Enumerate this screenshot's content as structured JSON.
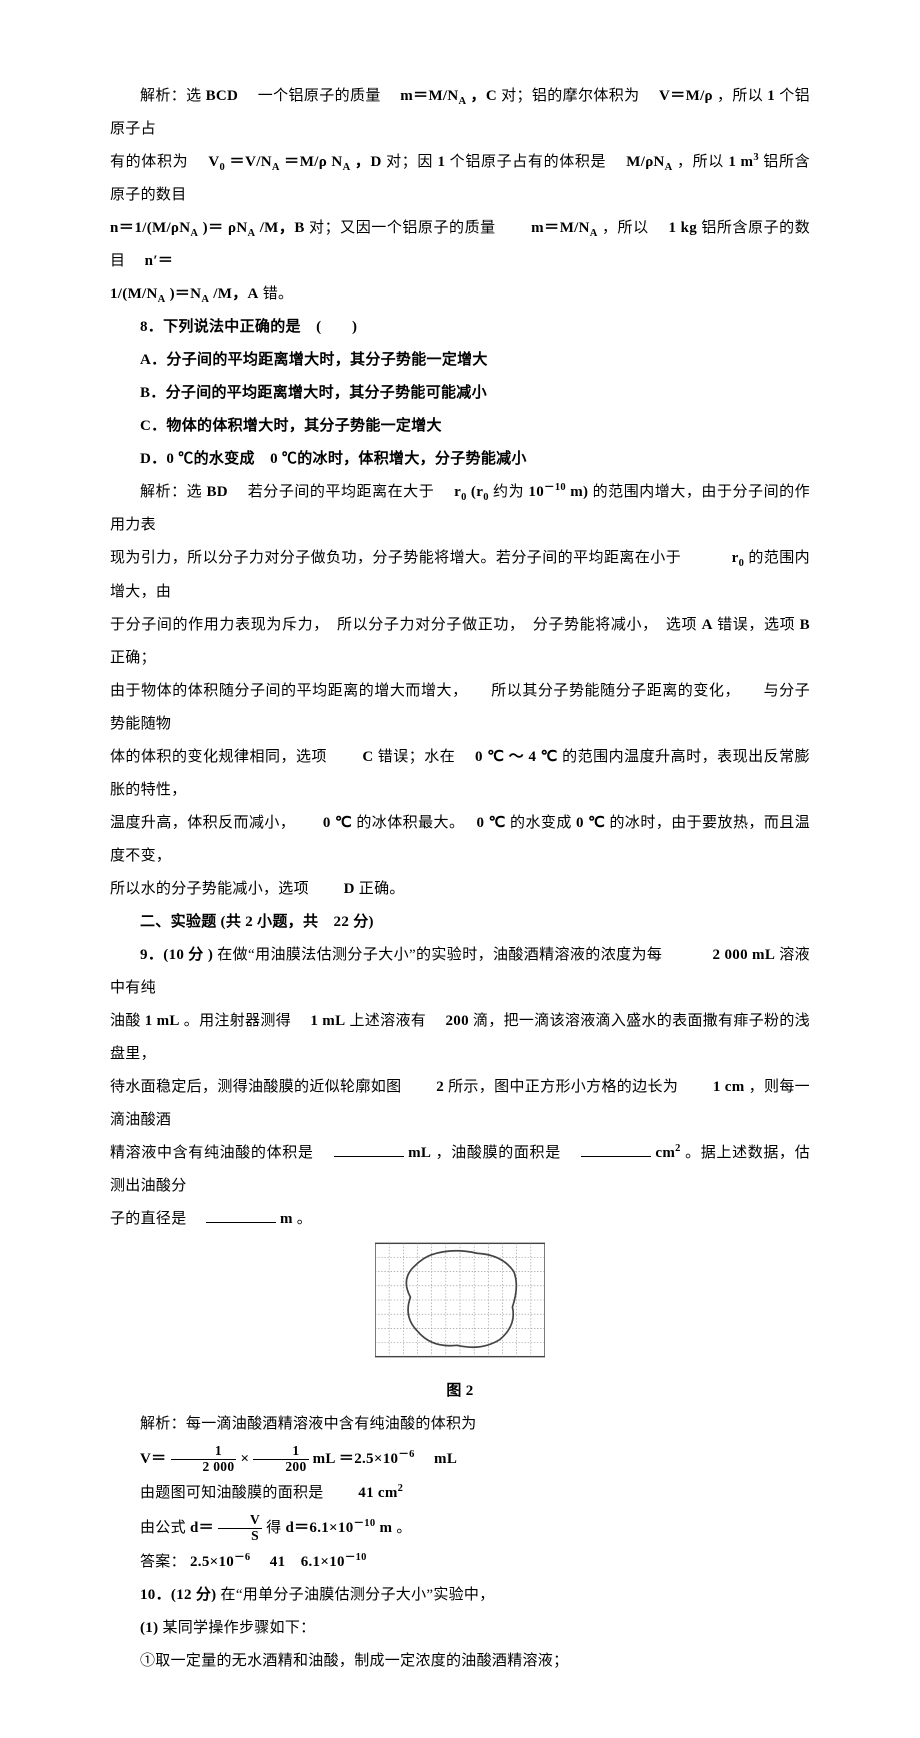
{
  "p7_analysis": {
    "t1": "解析：选 ",
    "t2": "BCD",
    "t3": "　一个铝原子的质量　",
    "t4": "m＝M/N",
    "t5": "A",
    "t6": "，C",
    "t7": " 对；铝的摩尔体积为　",
    "t8": "V＝M/ρ",
    "t9": "，所以 ",
    "t10": "1",
    "t11": " 个铝原子占",
    "t12": "有的体积为　",
    "t13": "V",
    "t14": "0",
    "t15": "＝V/N",
    "t16": "A",
    "t17": "＝M/ρ N",
    "t18": "A",
    "t19": "，D",
    "t20": " 对；因 ",
    "t21": "1",
    "t22": " 个铝原子占有的体积是　",
    "t23": "M/ρN",
    "t24": "A",
    "t25": "，所以 ",
    "t26": "1 m",
    "t27": "3",
    "t28": " 铝所含原子的数目",
    "t29": "n＝1/(M/ρN",
    "t30": "A",
    "t31": ")＝ ρN",
    "t32": "A",
    "t33": "/M，B",
    "t34": " 对；又因一个铝原子的质量　　",
    "t35": "m＝M/N",
    "t36": "A",
    "t37": "，所以　",
    "t38": "1 kg",
    "t39": " 铝所含原子的数目　",
    "t40": "n′＝",
    "t41": "1/(M/N",
    "t42": "A",
    "t43": ")＝N",
    "t44": "A",
    "t45": "/M，A",
    "t46": " 错。"
  },
  "q8": {
    "stem": "8．下列说法中正确的是　(　　)",
    "optA": "A．分子间的平均距离增大时，其分子势能一定增大",
    "optB": "B．分子间的平均距离增大时，其分子势能可能减小",
    "optC": "C．物体的体积增大时，其分子势能一定增大",
    "optD": "D．0 ℃的水变成　0 ℃的冰时，体积增大，分子势能减小"
  },
  "p8_analysis": {
    "t1": "解析：选 ",
    "t2": "BD",
    "t3": "　若分子间的平均距离在大于　",
    "t4": "r",
    "t5": "0",
    "t6": "(r",
    "t7": "0",
    "t8": " 约为 ",
    "t9": "10",
    "t10": "－10",
    "t11": " m)",
    "t12": " 的范围内增大，由于分子间的作用力表",
    "t13": "现为引力，所以分子力对分子做负功，分子势能将增大。若分子间的平均距离在小于　　　",
    "t14": "r",
    "t15": "0",
    "t16": " 的范围内增大，由",
    "t17": "于分子间的作用力表现为斥力，　所以分子力对分子做正功，　分子势能将减小，　选项 ",
    "t18": "A",
    "t19": " 错误，选项 ",
    "t20": "B",
    "t21": " 正确；",
    "t22": "由于物体的体积随分子间的平均距离的增大而增大，　　所以其分子势能随分子距离的变化，　　与分子势能随物",
    "t23": "体的体积的变化规律相同，选项　　",
    "t24": "C",
    "t25": " 错误；水在　",
    "t26": "0 ℃ ～ 4 ℃",
    "t27": " 的范围内温度升高时，表现出反常膨胀的特性，",
    "t28": "温度升高，体积反而减小，　　",
    "t29": "0 ℃",
    "t30": " 的冰体积最大。　",
    "t31": "0 ℃",
    "t32": " 的水变成 ",
    "t33": "0 ℃",
    "t34": " 的冰时，由于要放热，而且温度不变，",
    "t35": "所以水的分子势能减小，选项　　",
    "t36": "D",
    "t37": " 正确。"
  },
  "sec2": "二、实验题 (共 2 小题，共　22 分)",
  "q9": {
    "t1": "9．(10 分 )",
    "t2": "在做“用油膜法估测分子大小”的实验时，油酸酒精溶液的浓度为每　　　",
    "t3": "2 000 mL",
    "t4": " 溶液中有纯",
    "t5": "油酸 ",
    "t6": "1 mL",
    "t7": "。用注射器测得　",
    "t8": "1 mL",
    "t9": " 上述溶液有　",
    "t10": "200",
    "t11": " 滴，把一滴该溶液滴入盛水的表面撒有痱子粉的浅盘里，",
    "t12": "待水面稳定后，测得油酸膜的近似轮廓如图　　",
    "t13": "2",
    "t14": " 所示，图中正方形小方格的边长为　　",
    "t15": "1 cm",
    "t16": "，则每一滴油酸酒",
    "t17": "精溶液中含有纯油酸的体积是　",
    "t18": "mL",
    "t19": "，油酸膜的面积是　",
    "t20": "cm",
    "t21": "2",
    "t22": "。据上述数据，估测出油酸分",
    "t23": "子的直径是　",
    "t24": "m",
    "t25": "。"
  },
  "fig2": "图 2",
  "q9_sol": {
    "t1": "解析：每一滴油酸酒精溶液中含有纯油酸的体积为",
    "t2": "V＝",
    "num1": "1",
    "den1": "2 000",
    "t2b": "×",
    "num2": "1",
    "den2": "200",
    "t3": " mL ＝2.5×10",
    "t4": "－6",
    "t5": "　mL",
    "t6": "由题图可知油酸膜的面积是　　",
    "t7": "41 cm",
    "t8": "2",
    "t9": "由公式 ",
    "t10": "d＝",
    "num3": "V",
    "den3": "S",
    "t11": "得 ",
    "t12": "d＝6.1×10",
    "t13": "－10",
    "t14": "m",
    "t15": "。",
    "t16": "答案：",
    "t17": "2.5×10",
    "t18": "－6",
    "t19": "　41　6.1×10",
    "t20": "－10"
  },
  "q10": {
    "t1": "10．(12 分)",
    "t2": "在“用单分子油膜估测分子大小”实验中，",
    "t3": "(1)",
    "t4": "某同学操作步骤如下：",
    "t5": "①取一定量的无水酒精和油酸，制成一定浓度的油酸酒精溶液；"
  }
}
